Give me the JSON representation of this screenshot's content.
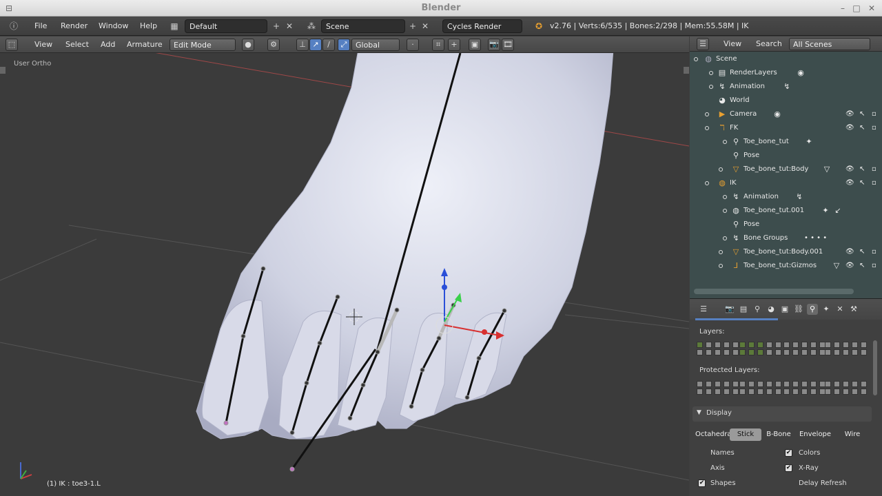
{
  "window": {
    "title": "Blender"
  },
  "infobar": {
    "menus": [
      "File",
      "Render",
      "Window",
      "Help"
    ],
    "layout": "Default",
    "scene": "Scene",
    "engine": "Cycles Render",
    "stats": "v2.76 | Verts:6/535 | Bones:2/298 | Mem:55.58M | IK"
  },
  "viewport_header": {
    "menus": [
      "View",
      "Select",
      "Add",
      "Armature"
    ],
    "mode": "Edit Mode",
    "orientation": "Global"
  },
  "viewport": {
    "view_label": "User Ortho",
    "status": "(1) IK : toe3-1.L"
  },
  "outliner": {
    "header": {
      "view": "View",
      "search": "Search",
      "filter": "All Scenes"
    },
    "rows": [
      {
        "label": "Scene"
      },
      {
        "label": "RenderLayers"
      },
      {
        "label": "Animation"
      },
      {
        "label": "World"
      },
      {
        "label": "Camera"
      },
      {
        "label": "FK"
      },
      {
        "label": "Toe_bone_tut"
      },
      {
        "label": "Pose"
      },
      {
        "label": "Toe_bone_tut:Body"
      },
      {
        "label": "IK"
      },
      {
        "label": "Animation"
      },
      {
        "label": "Toe_bone_tut.001"
      },
      {
        "label": "Pose"
      },
      {
        "label": "Bone Groups"
      },
      {
        "label": "Toe_bone_tut:Body.001"
      },
      {
        "label": "Toe_bone_tut:Gizmos"
      }
    ]
  },
  "properties": {
    "layers_label": "Layers:",
    "protected_label": "Protected Layers:",
    "display_label": "Display",
    "display_modes": [
      "Octahedral",
      "Stick",
      "B-Bone",
      "Envelope",
      "Wire"
    ],
    "active_mode": "Stick",
    "options": {
      "names": "Names",
      "colors": "Colors",
      "axis": "Axis",
      "xray": "X-Ray",
      "shapes": "Shapes",
      "delay_refresh": "Delay Refresh"
    }
  },
  "colors": {
    "outliner_bg": "#3d4d4d",
    "accent": "#5680c2",
    "mesh": "#d9dbe8"
  }
}
